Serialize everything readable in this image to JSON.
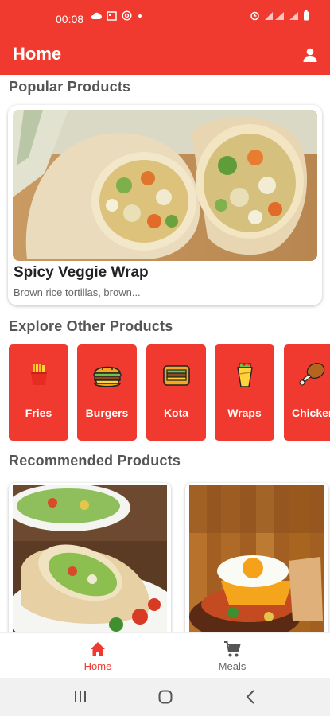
{
  "status_bar": {
    "time": "00:08",
    "left_icons": [
      "cloud-icon",
      "calendar-icon",
      "at-icon",
      "dot-icon"
    ],
    "right_icons": [
      "alarm-icon",
      "signal-icon",
      "wifi-icon",
      "battery-icon"
    ]
  },
  "app_bar": {
    "title": "Home",
    "action_icon": "user-icon"
  },
  "popular": {
    "section_title": "Popular Products",
    "item": {
      "name": "Spicy Veggie Wrap",
      "description": "Brown rice tortillas, brown..."
    }
  },
  "explore": {
    "section_title": "Explore Other Products",
    "categories": [
      {
        "label": "Fries",
        "icon": "fries-icon"
      },
      {
        "label": "Burgers",
        "icon": "burger-icon"
      },
      {
        "label": "Kota",
        "icon": "kota-icon"
      },
      {
        "label": "Wraps",
        "icon": "wrap-icon"
      },
      {
        "label": "Chicken",
        "icon": "chicken-leg-icon"
      }
    ]
  },
  "recommended": {
    "section_title": "Recommended Products",
    "items": [
      {
        "image": "wrap-plate-photo"
      },
      {
        "image": "burger-egg-photo"
      }
    ]
  },
  "bottom_nav": {
    "items": [
      {
        "label": "Home",
        "icon": "home-icon",
        "active": true
      },
      {
        "label": "Meals",
        "icon": "cart-icon",
        "active": false
      }
    ]
  },
  "colors": {
    "primary": "#f03a2f",
    "inactive": "#666666"
  }
}
